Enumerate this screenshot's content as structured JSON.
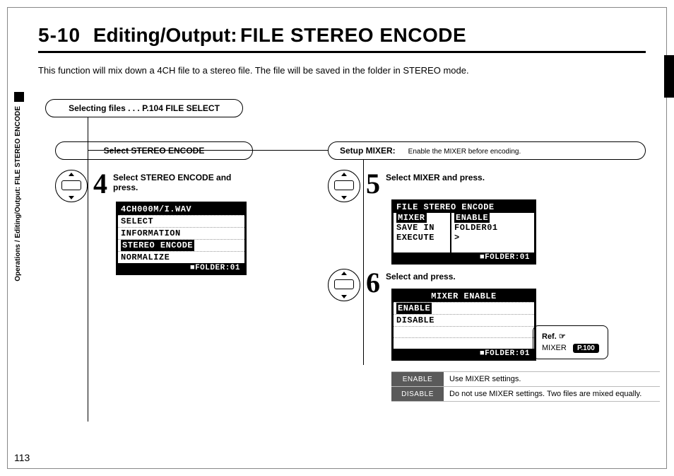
{
  "title": {
    "section": "5-10",
    "name": "Editing/Output:",
    "topic": "FILE STEREO ENCODE"
  },
  "intro": "This function will mix down a 4CH file to a stereo file. The file will be saved in the folder in STEREO mode.",
  "sidebar": {
    "path1": "Operations / Editing/Output:",
    "path2": "FILE STEREO ENCODE"
  },
  "page_number": "113",
  "tree": {
    "root": "Selecting files . . . P.104 FILE SELECT",
    "left": "Select STEREO ENCODE",
    "right": "Setup MIXER:",
    "right_hint": "Enable the MIXER before encoding."
  },
  "step4": {
    "num": "4",
    "label": "Select STEREO ENCODE and press.",
    "lcd": {
      "header": "4CH000M/I.WAV",
      "rows": [
        "SELECT",
        "INFORMATION",
        "STEREO ENCODE",
        "NORMALIZE"
      ],
      "selected_index": 2,
      "footer": "■FOLDER:01"
    }
  },
  "step5": {
    "num": "5",
    "label": "Select MIXER and press.",
    "lcd": {
      "header": "FILE STEREO ENCODE",
      "rows": [
        {
          "l": "MIXER",
          "r": "ENABLE",
          "sel": true
        },
        {
          "l": "SAVE IN",
          "r": "FOLDER01"
        },
        {
          "l": "EXECUTE",
          "r": ">"
        }
      ],
      "footer": "■FOLDER:01"
    }
  },
  "step6": {
    "num": "6",
    "label": "Select and press.",
    "lcd": {
      "header": "MIXER ENABLE",
      "rows": [
        "ENABLE",
        "DISABLE"
      ],
      "selected_index": 0,
      "footer": "■FOLDER:01"
    }
  },
  "ref": {
    "title": "Ref. ☞",
    "label": "MIXER",
    "page": "P.100"
  },
  "table": {
    "rows": [
      {
        "key": "ENABLE",
        "val": "Use MIXER settings."
      },
      {
        "key": "DISABLE",
        "val": "Do not use MIXER settings. Two files are mixed equally."
      }
    ]
  }
}
